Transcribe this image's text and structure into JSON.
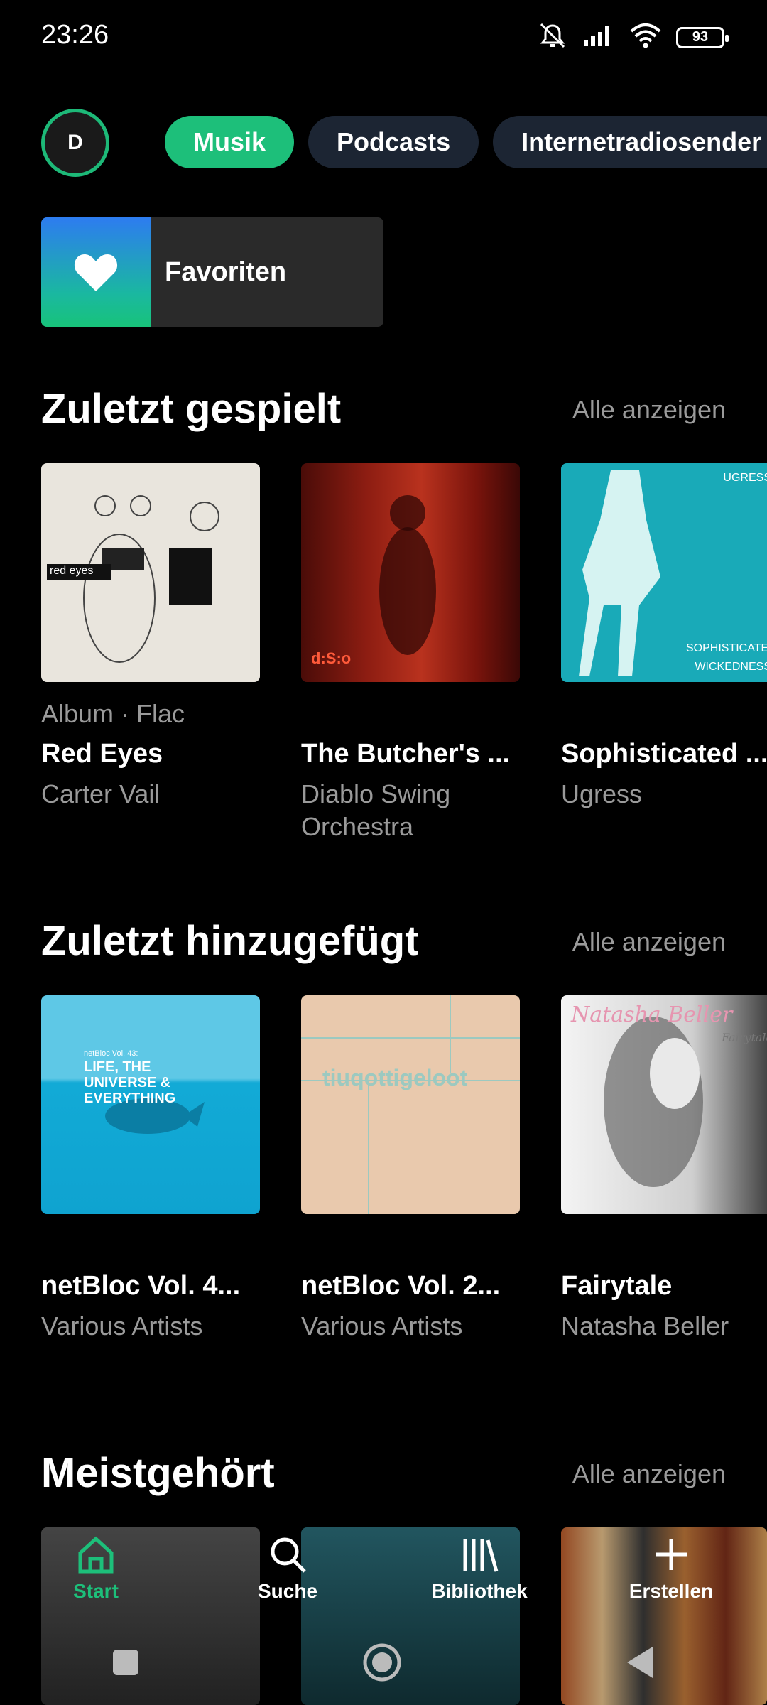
{
  "status": {
    "time": "23:26",
    "battery": "93"
  },
  "profile": {
    "initial": "D"
  },
  "chips": [
    "Musik",
    "Podcasts",
    "Internetradiosender"
  ],
  "favorites": {
    "label": "Favoriten"
  },
  "sections": [
    {
      "title": "Zuletzt gespielt",
      "see_all": "Alle anzeigen",
      "items": [
        {
          "meta": "Album · Flac",
          "title": "Red Eyes",
          "artist": "Carter Vail",
          "cover_text": "red eyes"
        },
        {
          "title": "The Butcher's ...",
          "artist": "Diablo Swing Orchestra",
          "cover_text": "d:S:o"
        },
        {
          "title": "Sophisticated ...",
          "artist": "Ugress",
          "cover_text": "UGRESS",
          "cover_text2": "SOPHISTICATED WICKEDNESS"
        }
      ]
    },
    {
      "title": "Zuletzt hinzugefügt",
      "see_all": "Alle anzeigen",
      "items": [
        {
          "title": "netBloc Vol. 4...",
          "artist": "Various Artists",
          "cover_text": "netBloc Vol. 43:",
          "cover_text2": "LIFE, THE UNIVERSE & EVERYTHING"
        },
        {
          "title": "netBloc Vol. 2...",
          "artist": "Various Artists",
          "cover_text": "tiuqottigeloot"
        },
        {
          "title": "Fairytale",
          "artist": "Natasha Beller",
          "cover_text": "Natasha Beller",
          "cover_text2": "Fairytale"
        }
      ]
    },
    {
      "title": "Meistgehört",
      "see_all": "Alle anzeigen"
    }
  ],
  "nav": [
    "Start",
    "Suche",
    "Bibliothek",
    "Erstellen"
  ]
}
